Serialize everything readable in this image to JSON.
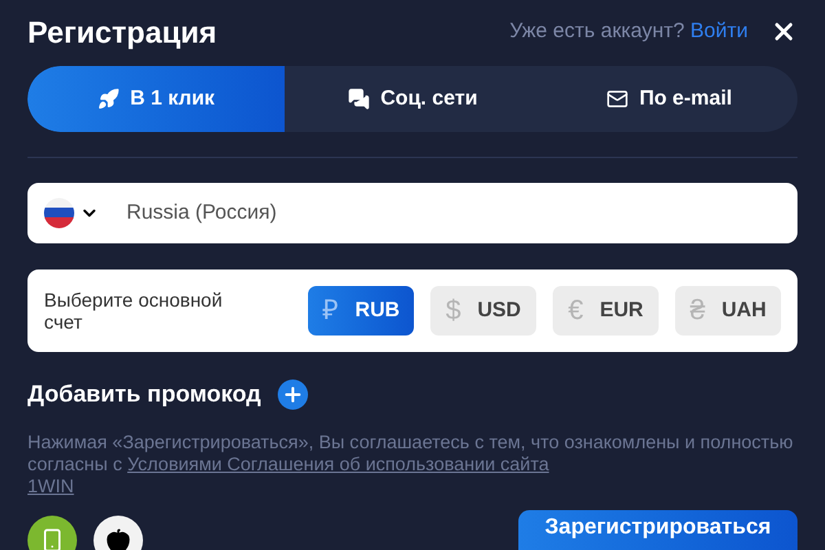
{
  "title": "Регистрация",
  "login_prompt": {
    "text": "Уже есть аккаунт?",
    "link": "Войти"
  },
  "tabs": [
    {
      "label": "В 1 клик",
      "kind": "rocket",
      "selected": true
    },
    {
      "label": "Соц. сети",
      "kind": "chat",
      "selected": false
    },
    {
      "label": "По e-mail",
      "kind": "mail",
      "selected": false
    }
  ],
  "country": {
    "value": "Russia (Россия)"
  },
  "currency": {
    "label": "Выберите основной счет",
    "options": [
      {
        "code": "RUB",
        "symbol": "₽",
        "selected": true
      },
      {
        "code": "USD",
        "symbol": "$",
        "selected": false
      },
      {
        "code": "EUR",
        "symbol": "€",
        "selected": false
      },
      {
        "code": "UAH",
        "symbol": "₴",
        "selected": false
      }
    ]
  },
  "promo": {
    "label": "Добавить промокод"
  },
  "terms": {
    "text": "Нажимая «Зарегистрироваться», Вы соглашаетесь с тем, что ознакомлены и полностью согласны с",
    "link_lines": [
      "Условиями Соглашения об использовании сайта",
      "1WIN"
    ]
  },
  "register_button": "Зарегистрироваться"
}
